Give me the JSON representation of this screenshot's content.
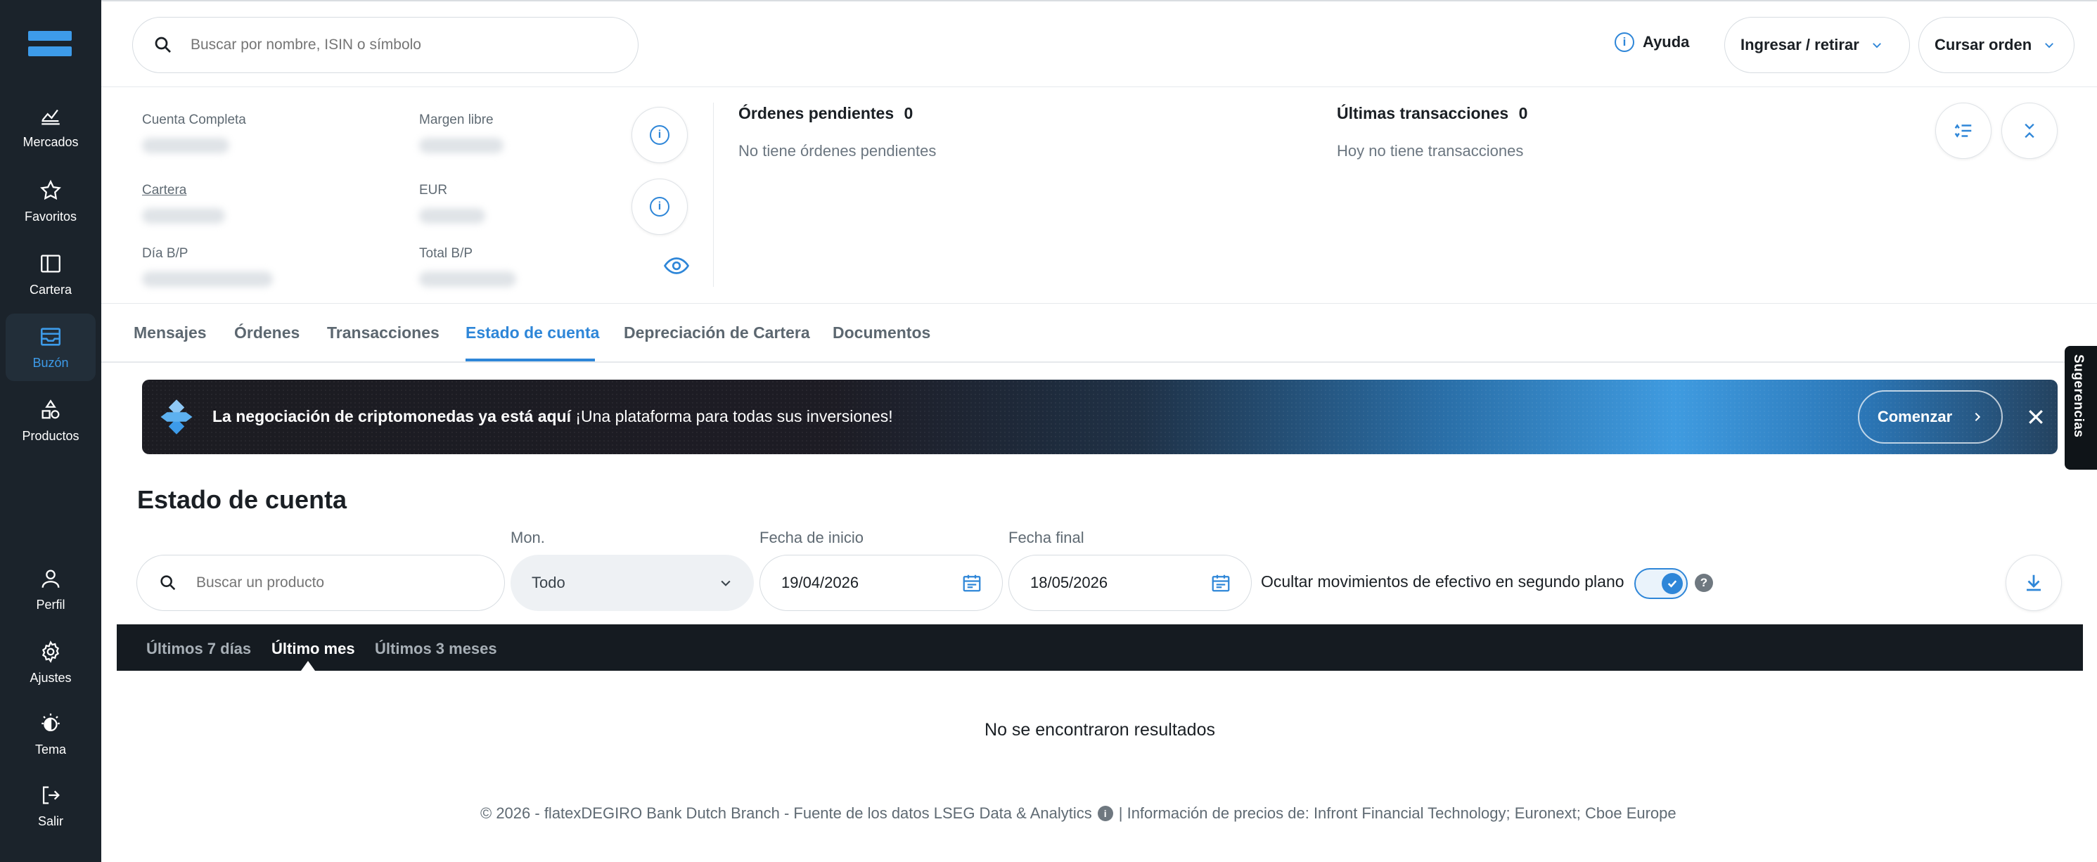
{
  "sidebar": {
    "items": [
      {
        "label": "Mercados",
        "icon": "chart-icon"
      },
      {
        "label": "Favoritos",
        "icon": "star-icon"
      },
      {
        "label": "Cartera",
        "icon": "portfolio-icon"
      },
      {
        "label": "Buzón",
        "icon": "inbox-icon",
        "active": true
      },
      {
        "label": "Productos",
        "icon": "shapes-icon"
      },
      {
        "label": "Perfil",
        "icon": "user-icon"
      },
      {
        "label": "Ajustes",
        "icon": "gear-icon"
      },
      {
        "label": "Tema",
        "icon": "theme-icon"
      },
      {
        "label": "Salir",
        "icon": "logout-icon"
      }
    ]
  },
  "header": {
    "search_placeholder": "Buscar por nombre, ISIN o símbolo",
    "help_label": "Ayuda",
    "deposit_label": "Ingresar / retirar",
    "order_label": "Cursar orden"
  },
  "summary": {
    "full_account_label": "Cuenta Completa",
    "free_margin_label": "Margen libre",
    "portfolio_label": "Cartera",
    "currency_label": "EUR",
    "day_pl_label": "Día B/P",
    "total_pl_label": "Total B/P",
    "pending_orders_title": "Órdenes pendientes",
    "pending_orders_count": "0",
    "pending_orders_empty": "No tiene órdenes pendientes",
    "last_transactions_title": "Últimas transacciones",
    "last_transactions_count": "0",
    "last_transactions_empty": "Hoy no tiene transacciones"
  },
  "tabs": [
    {
      "label": "Mensajes"
    },
    {
      "label": "Órdenes"
    },
    {
      "label": "Transacciones"
    },
    {
      "label": "Estado de cuenta",
      "active": true
    },
    {
      "label": "Depreciación de Cartera"
    },
    {
      "label": "Documentos"
    }
  ],
  "banner": {
    "bold_text": "La negociación de criptomonedas ya está aquí",
    "text": " ¡Una plataforma para todas sus inversiones!",
    "button_label": "Comenzar"
  },
  "statement": {
    "title": "Estado de cuenta",
    "product_search_placeholder": "Buscar un producto",
    "currency_label": "Mon.",
    "currency_value": "Todo",
    "start_date_label": "Fecha de inicio",
    "start_date_value": "19/04/2026",
    "end_date_label": "Fecha final",
    "end_date_value": "18/05/2026",
    "hide_cash_label": "Ocultar movimientos de efectivo en segundo plano",
    "hide_cash_enabled": true,
    "ranges": [
      {
        "label": "Últimos 7 días"
      },
      {
        "label": "Último mes",
        "active": true
      },
      {
        "label": "Últimos 3 meses"
      }
    ],
    "empty_text": "No se encontraron resultados"
  },
  "footer": {
    "left": "© 2026 - flatexDEGIRO Bank Dutch Branch - Fuente de los datos LSEG Data & Analytics",
    "right": "| Información de precios de: Infront Financial Technology; Euronext; Cboe Europe"
  },
  "suggestions_label": "Sugerencias",
  "colors": {
    "accent": "#2e86d8",
    "sidebar_bg": "#1b232b",
    "range_bar_bg": "#151b21"
  }
}
